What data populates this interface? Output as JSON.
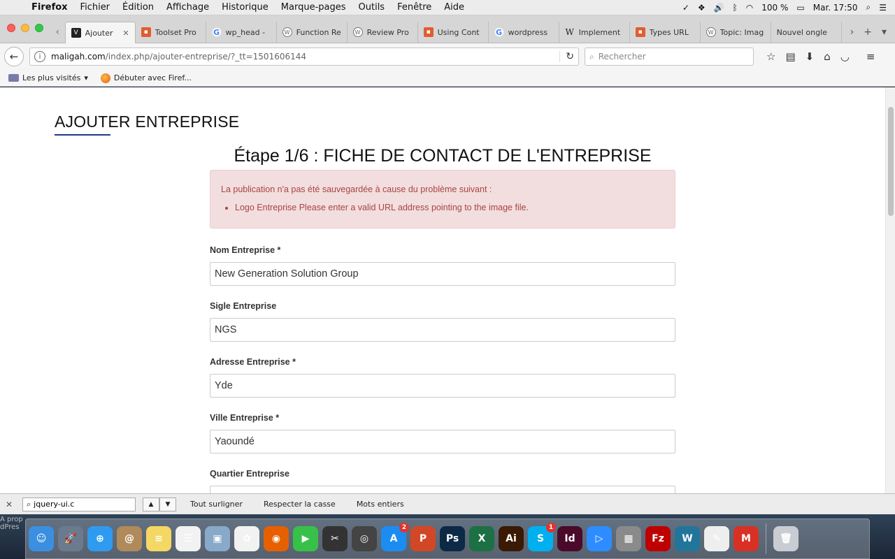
{
  "menubar": {
    "apple": "",
    "items": [
      "Firefox",
      "Fichier",
      "Édition",
      "Affichage",
      "Historique",
      "Marque-pages",
      "Outils",
      "Fenêtre",
      "Aide"
    ],
    "battery": "100 %",
    "clock": "Mar. 17:50"
  },
  "tabs": [
    {
      "label": "Ajouter",
      "icon": "v",
      "active": true
    },
    {
      "label": "Toolset Pro",
      "icon": "toolset"
    },
    {
      "label": "wp_head -",
      "icon": "google"
    },
    {
      "label": "Function Re",
      "icon": "wp"
    },
    {
      "label": "Review Pro",
      "icon": "wp"
    },
    {
      "label": "Using Cont",
      "icon": "toolset"
    },
    {
      "label": "wordpress",
      "icon": "google"
    },
    {
      "label": "Implement",
      "icon": "wiki"
    },
    {
      "label": "Types URL",
      "icon": "toolset"
    },
    {
      "label": "Topic: Imag",
      "icon": "wp"
    },
    {
      "label": "Nouvel ongle",
      "icon": "none"
    }
  ],
  "navbar": {
    "url_domain": "maligah.com",
    "url_path": "/index.php/ajouter-entreprise/?_tt=1501606144",
    "search_placeholder": "Rechercher"
  },
  "bookmarks": {
    "most_visited": "Les plus visités",
    "getting_started": "Débuter avec Firef..."
  },
  "page": {
    "heading": "AJOUTER ENTREPRISE",
    "step_title": "Étape 1/6 : FICHE DE CONTACT DE L'ENTREPRISE",
    "alert": {
      "message": "La publication n'a pas été sauvegardée à cause du problème suivant :",
      "errors": [
        "Logo Entreprise Please enter a valid URL address pointing to the image file."
      ]
    },
    "fields": [
      {
        "label": "Nom Entreprise *",
        "value": "New Generation Solution Group"
      },
      {
        "label": "Sigle Entreprise",
        "value": "NGS"
      },
      {
        "label": "Adresse Entreprise *",
        "value": "Yde"
      },
      {
        "label": "Ville Entreprise *",
        "value": "Yaoundé"
      },
      {
        "label": "Quartier Entreprise",
        "value": ""
      }
    ]
  },
  "findbar": {
    "query": "jquery-ui.c",
    "highlight_all": "Tout surligner",
    "match_case": "Respecter la casse",
    "whole_words": "Mots entiers"
  },
  "dock": {
    "side_text_1": "A prop",
    "side_text_2": "dPres",
    "apps": [
      {
        "name": "finder-icon",
        "color": "#3b8fe0",
        "glyph": "☺"
      },
      {
        "name": "launchpad-icon",
        "color": "#6b7a8c",
        "glyph": "🚀"
      },
      {
        "name": "safari-icon",
        "color": "#2e9bf0",
        "glyph": "⊕"
      },
      {
        "name": "contacts-icon",
        "color": "#b08a5a",
        "glyph": "@"
      },
      {
        "name": "notes-icon",
        "color": "#f5d763",
        "glyph": "≡"
      },
      {
        "name": "reminders-icon",
        "color": "#f2f2f2",
        "glyph": "☰"
      },
      {
        "name": "preview-icon",
        "color": "#88a9c9",
        "glyph": "▣"
      },
      {
        "name": "photos-icon",
        "color": "#f2f2f2",
        "glyph": "✿"
      },
      {
        "name": "firefox-icon",
        "color": "#e66000",
        "glyph": "◉"
      },
      {
        "name": "facetime-icon",
        "color": "#38c149",
        "glyph": "▶"
      },
      {
        "name": "final-cut-icon",
        "color": "#333",
        "glyph": "✂"
      },
      {
        "name": "dvd-player-icon",
        "color": "#444",
        "glyph": "◎"
      },
      {
        "name": "app-store-icon",
        "color": "#1c8df0",
        "glyph": "A",
        "badge": "2"
      },
      {
        "name": "powerpoint-icon",
        "color": "#d24726",
        "glyph": "P"
      },
      {
        "name": "photoshop-icon",
        "color": "#0c2a46",
        "glyph": "Ps"
      },
      {
        "name": "excel-icon",
        "color": "#1d7044",
        "glyph": "X"
      },
      {
        "name": "illustrator-icon",
        "color": "#3a1a04",
        "glyph": "Ai"
      },
      {
        "name": "skype-icon",
        "color": "#00aff0",
        "glyph": "S",
        "badge": "1"
      },
      {
        "name": "indesign-icon",
        "color": "#4b0a2a",
        "glyph": "Id"
      },
      {
        "name": "zoom-icon",
        "color": "#2d8cff",
        "glyph": "▷"
      },
      {
        "name": "calculator-icon",
        "color": "#8a8a8a",
        "glyph": "▦"
      },
      {
        "name": "filezilla-icon",
        "color": "#bf0000",
        "glyph": "Fz"
      },
      {
        "name": "wordpress-app-icon",
        "color": "#21759b",
        "glyph": "W"
      },
      {
        "name": "textedit-icon",
        "color": "#eeeeee",
        "glyph": "✎"
      },
      {
        "name": "gmail-icon",
        "color": "#d93025",
        "glyph": "M"
      },
      {
        "name": "trash-icon",
        "color": "#c9ccd2",
        "glyph": "🗑"
      }
    ]
  }
}
